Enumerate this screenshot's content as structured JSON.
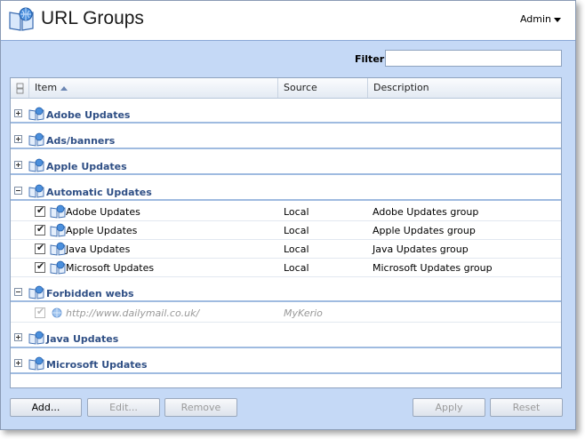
{
  "window": {
    "title": "URL Groups",
    "user_menu": "Admin"
  },
  "filter": {
    "label": "Filter:",
    "value": ""
  },
  "grid": {
    "columns": {
      "item": "Item",
      "source": "Source",
      "description": "Description"
    },
    "groups": [
      {
        "label": "Adobe Updates",
        "expanded": false
      },
      {
        "label": "Ads/banners",
        "expanded": false
      },
      {
        "label": "Apple Updates",
        "expanded": false
      },
      {
        "label": "Automatic Updates",
        "expanded": true,
        "items": [
          {
            "label": "Adobe Updates",
            "source": "Local",
            "description": "Adobe Updates group",
            "checked": true
          },
          {
            "label": "Apple Updates",
            "source": "Local",
            "description": "Apple Updates group",
            "checked": true
          },
          {
            "label": "Java Updates",
            "source": "Local",
            "description": "Java Updates group",
            "checked": true
          },
          {
            "label": "Microsoft Updates",
            "source": "Local",
            "description": "Microsoft Updates group",
            "checked": true
          }
        ]
      },
      {
        "label": "Forbidden webs",
        "expanded": true,
        "items": [
          {
            "label": "http://www.dailymail.co.uk/",
            "source": "MyKerio",
            "description": "",
            "checked": true,
            "disabled": true
          }
        ]
      },
      {
        "label": "Java Updates",
        "expanded": false
      },
      {
        "label": "Microsoft Updates",
        "expanded": false
      }
    ]
  },
  "buttons": {
    "add": "Add...",
    "edit": "Edit...",
    "remove": "Remove",
    "apply": "Apply",
    "reset": "Reset"
  },
  "colors": {
    "group_text": "#2f4f85",
    "background": "#c5d9f6",
    "accent_line": "#9fbbe0"
  }
}
